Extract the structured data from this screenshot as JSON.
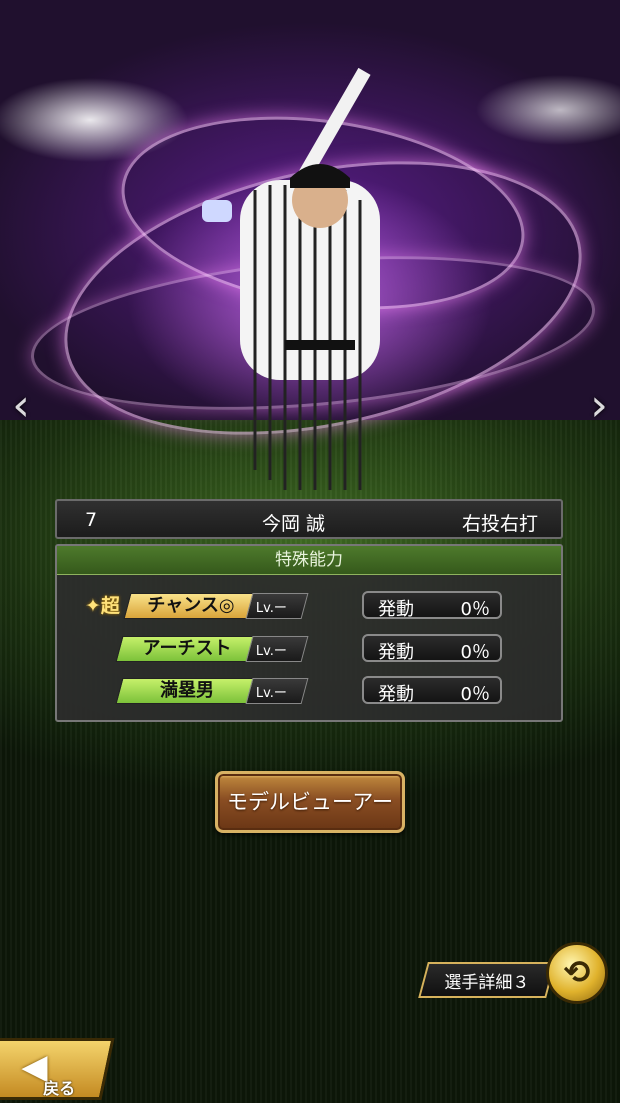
{
  "player": {
    "number": "7",
    "name": "今岡 誠",
    "bat_throw": "右投右打"
  },
  "special_abilities": {
    "title": "特殊能力",
    "super_mark": "✦超",
    "items": [
      {
        "name": "チャンス◎",
        "level": "Lv.ー",
        "trigger_label": "発動",
        "trigger_value": "0％",
        "super": true
      },
      {
        "name": "アーチスト",
        "level": "Lv.ー",
        "trigger_label": "発動",
        "trigger_value": "0％",
        "super": false
      },
      {
        "name": "満塁男",
        "level": "Lv.ー",
        "trigger_label": "発動",
        "trigger_value": "0％",
        "super": false
      }
    ]
  },
  "buttons": {
    "model_viewer": "モデルビューアー",
    "player_detail": "選手詳細３",
    "back": "戻る"
  },
  "nav": {
    "prev": "‹",
    "next": "›"
  },
  "icons": {
    "switch": "swap-arrows-icon",
    "back": "back-arrow-icon"
  },
  "colors": {
    "super_tag": "#e6b64a",
    "normal_tag": "#9ad84a",
    "header_green": "#4e7a2c",
    "button_brown": "#8a4e23",
    "gold": "#e0b22c"
  }
}
